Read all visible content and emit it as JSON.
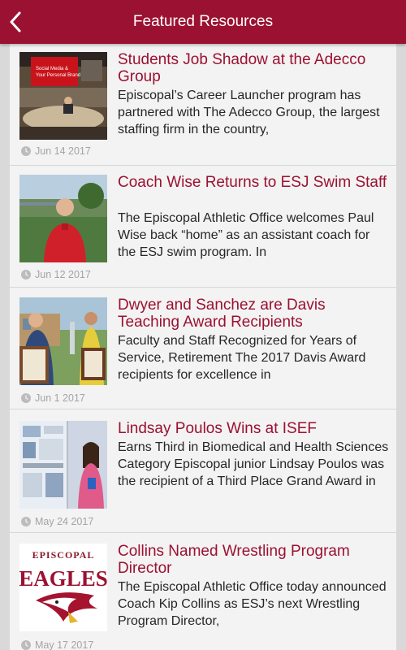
{
  "header": {
    "title": "Featured Resources",
    "back_icon": "chevron-left-icon",
    "background": "#9b1131"
  },
  "articles": [
    {
      "title": "Students Job Shadow at the Adecco Group",
      "summary": "Episcopal’s Career Launcher program has partnered with The Adecco Group, the largest staffing firm in the country,",
      "date": "Jun 14 2017",
      "image_text_1": "Social Media &",
      "image_text_2": "Your Personal Brand"
    },
    {
      "title": "Coach Wise Returns to ESJ Swim Staff",
      "summary": "The Episcopal Athletic Office welcomes Paul Wise back “home” as an assistant coach for the ESJ swim program. In",
      "date": "Jun 12 2017"
    },
    {
      "title": "Dwyer and Sanchez are Davis Teaching Award Recipients",
      "summary": "Faculty and Staff Recognized for Years of Service, Retirement The 2017 Davis Award recipients for excellence in",
      "date": "Jun 1 2017"
    },
    {
      "title": "Lindsay Poulos Wins at ISEF",
      "summary": "Earns Third in Biomedical and Health Sciences Category Episcopal junior Lindsay Poulos was the recipient of a Third Place Grand Award in the",
      "date": "May 24 2017"
    },
    {
      "title": "Collins Named Wrestling Program Director",
      "summary": "The Episcopal Athletic Office today announced Coach Kip Collins as ESJ’s next Wrestling Program Director,",
      "date": "May 17 2017",
      "image_text_1": "EPISCOPAL",
      "image_text_2": "EAGLES"
    }
  ]
}
